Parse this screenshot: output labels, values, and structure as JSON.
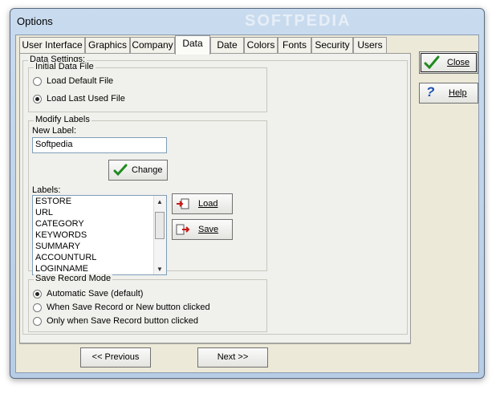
{
  "window": {
    "title": "Options",
    "watermark": "SOFTPEDIA"
  },
  "tabs": [
    {
      "label": "User Interface"
    },
    {
      "label": "Graphics"
    },
    {
      "label": "Company"
    },
    {
      "label": "Data",
      "active": true
    },
    {
      "label": "Date"
    },
    {
      "label": "Colors"
    },
    {
      "label": "Fonts"
    },
    {
      "label": "Security"
    },
    {
      "label": "Users"
    }
  ],
  "data_settings": {
    "legend": "Data Settings:",
    "initial_data_file": {
      "legend": "Initial Data File",
      "options": [
        "Load Default File",
        "Load Last Used File"
      ],
      "selected": "Load Last Used File"
    },
    "modify_labels": {
      "legend": "Modify Labels",
      "new_label_caption": "New Label:",
      "new_label_value": "Softpedia",
      "change_button": "Change",
      "labels_caption": "Labels:",
      "labels": [
        "ESTORE",
        "URL",
        "CATEGORY",
        "KEYWORDS",
        "SUMMARY",
        "ACCOUNTURL",
        "LOGINNAME"
      ],
      "load_button": "Load",
      "save_button": "Save"
    },
    "save_record_mode": {
      "legend": "Save Record Mode",
      "options": [
        "Automatic Save (default)",
        "When Save Record or New button clicked",
        "Only when Save Record button clicked"
      ],
      "selected": "Automatic Save (default)"
    }
  },
  "side_buttons": {
    "close": "Close",
    "help": "Help"
  },
  "nav": {
    "previous": "<< Previous",
    "next": "Next >>"
  },
  "colors": {
    "check_green": "#1f8a1f",
    "help_blue": "#1b4fb0",
    "title_bar": "#bfd3ea",
    "dialog_bg": "#ece9d8"
  }
}
